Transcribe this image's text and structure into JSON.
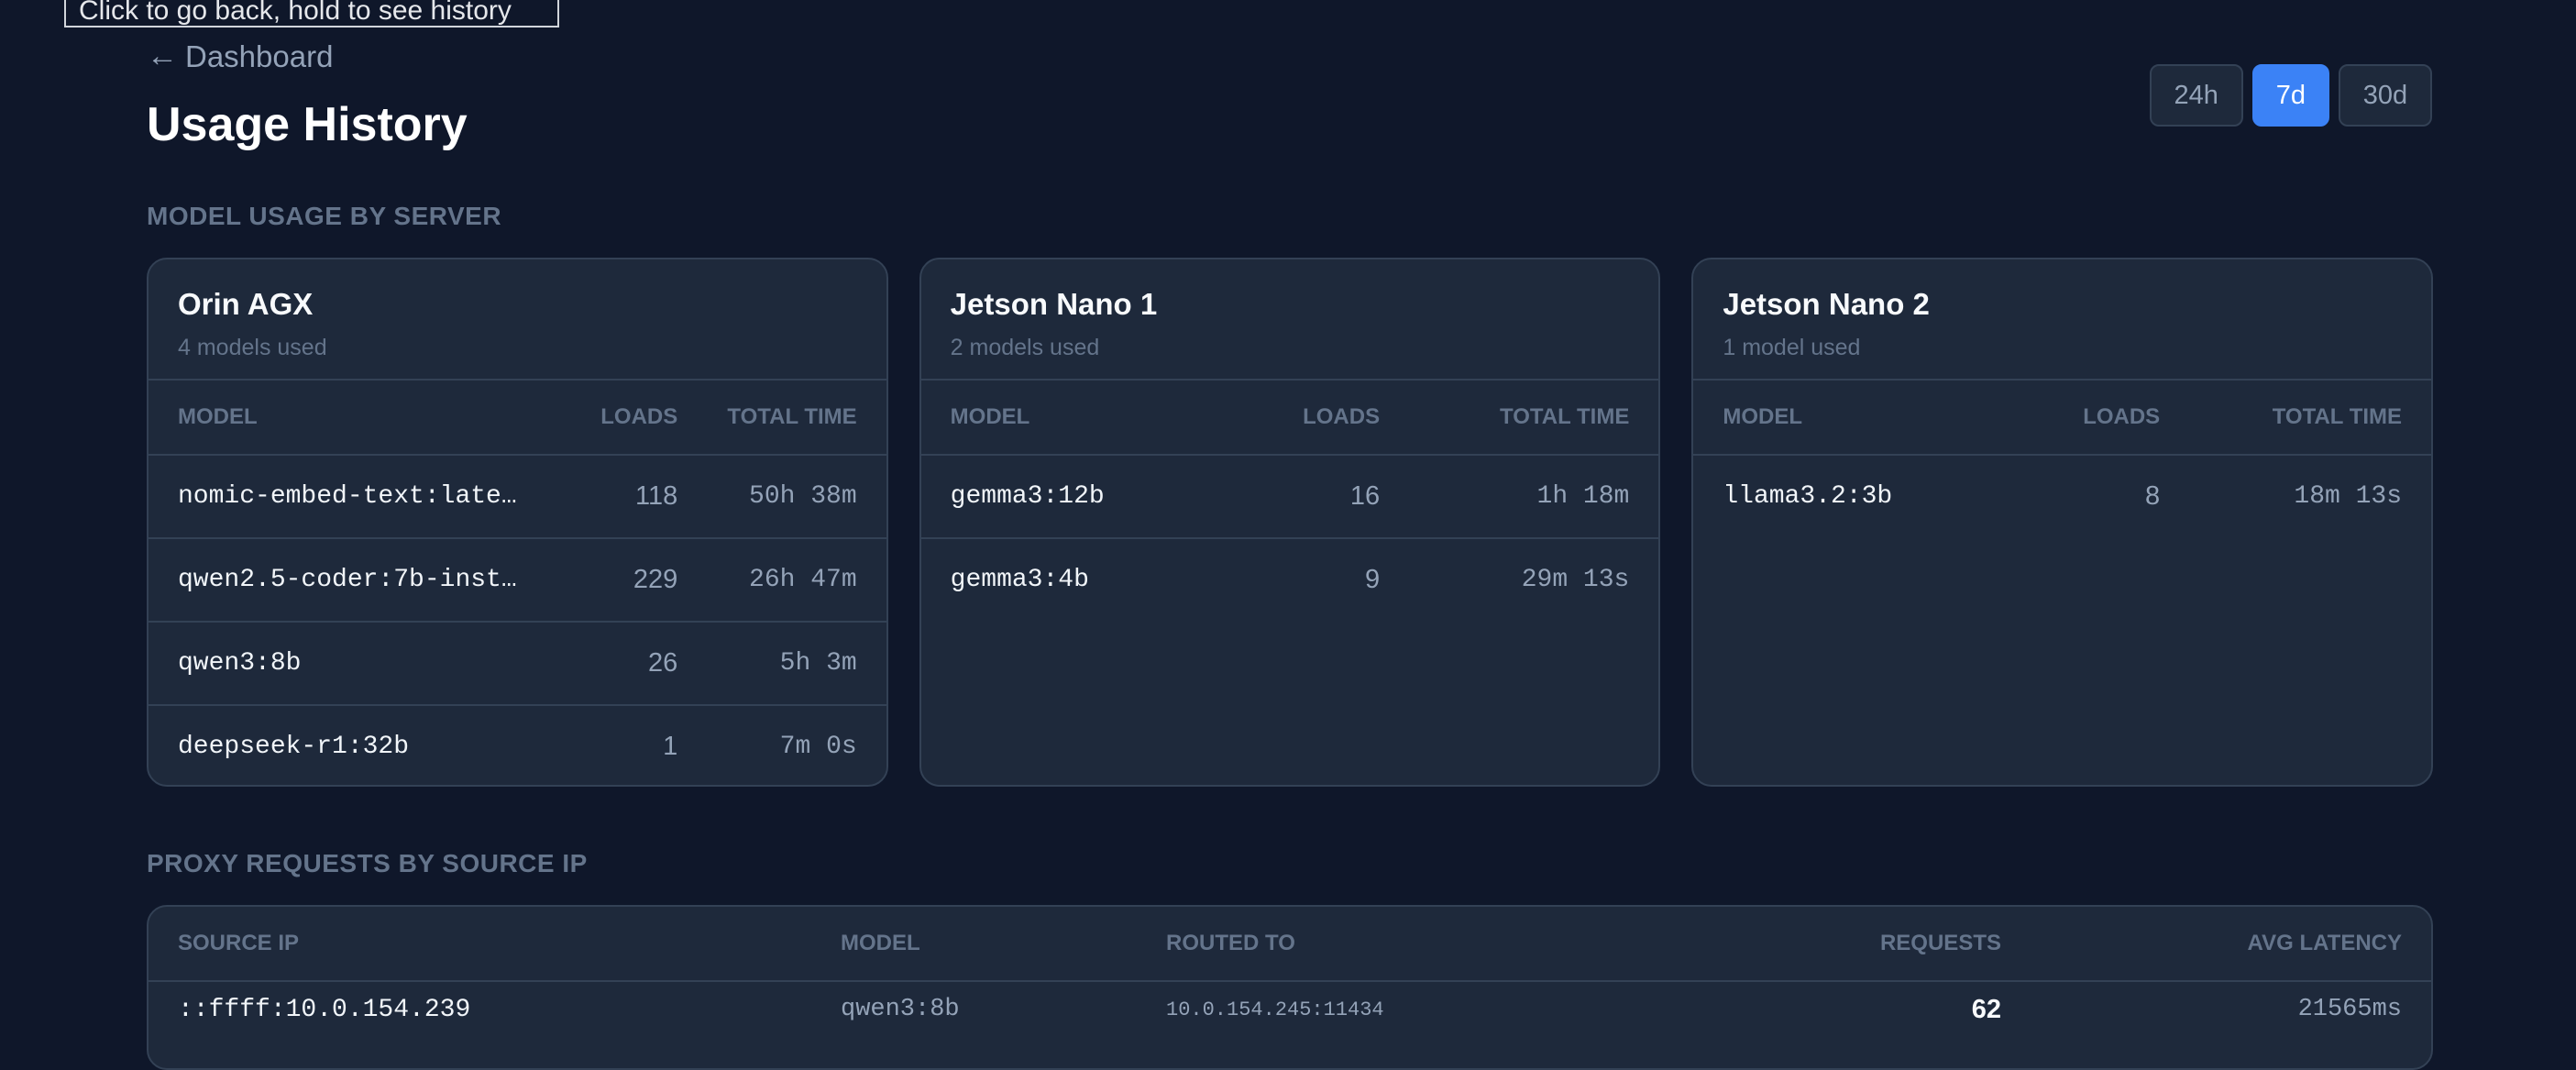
{
  "tooltip": "Click to go back, hold to see history",
  "nav": {
    "back_label": "Dashboard"
  },
  "page": {
    "title": "Usage History"
  },
  "ranges": [
    {
      "label": "24h",
      "active": false
    },
    {
      "label": "7d",
      "active": true
    },
    {
      "label": "30d",
      "active": false
    }
  ],
  "model_usage": {
    "section_label": "MODEL USAGE BY SERVER",
    "columns": {
      "model": "MODEL",
      "loads": "LOADS",
      "total_time": "TOTAL TIME"
    },
    "servers": [
      {
        "name": "Orin AGX",
        "subtitle": "4 models used",
        "rows": [
          {
            "model": "nomic-embed-text:late…",
            "loads": "118",
            "total_time": "50h 38m"
          },
          {
            "model": "qwen2.5-coder:7b-inst…",
            "loads": "229",
            "total_time": "26h 47m"
          },
          {
            "model": "qwen3:8b",
            "loads": "26",
            "total_time": "5h 3m"
          },
          {
            "model": "deepseek-r1:32b",
            "loads": "1",
            "total_time": "7m 0s"
          }
        ]
      },
      {
        "name": "Jetson Nano 1",
        "subtitle": "2 models used",
        "rows": [
          {
            "model": "gemma3:12b",
            "loads": "16",
            "total_time": "1h 18m"
          },
          {
            "model": "gemma3:4b",
            "loads": "9",
            "total_time": "29m 13s"
          }
        ]
      },
      {
        "name": "Jetson Nano 2",
        "subtitle": "1 model used",
        "rows": [
          {
            "model": "llama3.2:3b",
            "loads": "8",
            "total_time": "18m 13s"
          }
        ]
      }
    ]
  },
  "proxy": {
    "section_label": "PROXY REQUESTS BY SOURCE IP",
    "columns": {
      "source_ip": "SOURCE IP",
      "model": "MODEL",
      "routed_to": "ROUTED TO",
      "requests": "REQUESTS",
      "avg_latency": "AVG LATENCY"
    },
    "rows": [
      {
        "source_ip": "::ffff:10.0.154.239",
        "model": "qwen3:8b",
        "routed_to": "10.0.154.245:11434",
        "requests": "62",
        "avg_latency": "21565ms"
      }
    ]
  },
  "colors": {
    "background": "#0f172a",
    "card": "#1e293b",
    "border": "#334155",
    "accent": "#3b82f6"
  }
}
